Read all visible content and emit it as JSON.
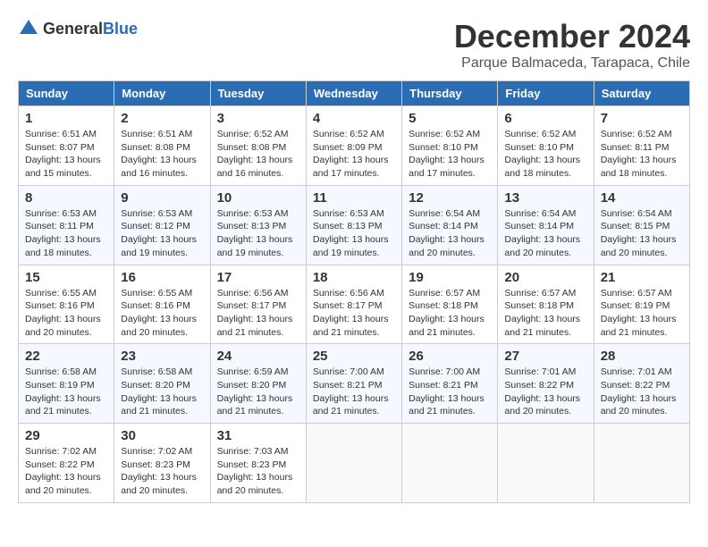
{
  "header": {
    "logo_general": "General",
    "logo_blue": "Blue",
    "month_year": "December 2024",
    "location": "Parque Balmaceda, Tarapaca, Chile"
  },
  "days_of_week": [
    "Sunday",
    "Monday",
    "Tuesday",
    "Wednesday",
    "Thursday",
    "Friday",
    "Saturday"
  ],
  "weeks": [
    [
      {
        "day": 1,
        "sunrise": "6:51 AM",
        "sunset": "8:07 PM",
        "daylight": "13 hours and 15 minutes."
      },
      {
        "day": 2,
        "sunrise": "6:51 AM",
        "sunset": "8:08 PM",
        "daylight": "13 hours and 16 minutes."
      },
      {
        "day": 3,
        "sunrise": "6:52 AM",
        "sunset": "8:08 PM",
        "daylight": "13 hours and 16 minutes."
      },
      {
        "day": 4,
        "sunrise": "6:52 AM",
        "sunset": "8:09 PM",
        "daylight": "13 hours and 17 minutes."
      },
      {
        "day": 5,
        "sunrise": "6:52 AM",
        "sunset": "8:10 PM",
        "daylight": "13 hours and 17 minutes."
      },
      {
        "day": 6,
        "sunrise": "6:52 AM",
        "sunset": "8:10 PM",
        "daylight": "13 hours and 18 minutes."
      },
      {
        "day": 7,
        "sunrise": "6:52 AM",
        "sunset": "8:11 PM",
        "daylight": "13 hours and 18 minutes."
      }
    ],
    [
      {
        "day": 8,
        "sunrise": "6:53 AM",
        "sunset": "8:11 PM",
        "daylight": "13 hours and 18 minutes."
      },
      {
        "day": 9,
        "sunrise": "6:53 AM",
        "sunset": "8:12 PM",
        "daylight": "13 hours and 19 minutes."
      },
      {
        "day": 10,
        "sunrise": "6:53 AM",
        "sunset": "8:13 PM",
        "daylight": "13 hours and 19 minutes."
      },
      {
        "day": 11,
        "sunrise": "6:53 AM",
        "sunset": "8:13 PM",
        "daylight": "13 hours and 19 minutes."
      },
      {
        "day": 12,
        "sunrise": "6:54 AM",
        "sunset": "8:14 PM",
        "daylight": "13 hours and 20 minutes."
      },
      {
        "day": 13,
        "sunrise": "6:54 AM",
        "sunset": "8:14 PM",
        "daylight": "13 hours and 20 minutes."
      },
      {
        "day": 14,
        "sunrise": "6:54 AM",
        "sunset": "8:15 PM",
        "daylight": "13 hours and 20 minutes."
      }
    ],
    [
      {
        "day": 15,
        "sunrise": "6:55 AM",
        "sunset": "8:16 PM",
        "daylight": "13 hours and 20 minutes."
      },
      {
        "day": 16,
        "sunrise": "6:55 AM",
        "sunset": "8:16 PM",
        "daylight": "13 hours and 20 minutes."
      },
      {
        "day": 17,
        "sunrise": "6:56 AM",
        "sunset": "8:17 PM",
        "daylight": "13 hours and 21 minutes."
      },
      {
        "day": 18,
        "sunrise": "6:56 AM",
        "sunset": "8:17 PM",
        "daylight": "13 hours and 21 minutes."
      },
      {
        "day": 19,
        "sunrise": "6:57 AM",
        "sunset": "8:18 PM",
        "daylight": "13 hours and 21 minutes."
      },
      {
        "day": 20,
        "sunrise": "6:57 AM",
        "sunset": "8:18 PM",
        "daylight": "13 hours and 21 minutes."
      },
      {
        "day": 21,
        "sunrise": "6:57 AM",
        "sunset": "8:19 PM",
        "daylight": "13 hours and 21 minutes."
      }
    ],
    [
      {
        "day": 22,
        "sunrise": "6:58 AM",
        "sunset": "8:19 PM",
        "daylight": "13 hours and 21 minutes."
      },
      {
        "day": 23,
        "sunrise": "6:58 AM",
        "sunset": "8:20 PM",
        "daylight": "13 hours and 21 minutes."
      },
      {
        "day": 24,
        "sunrise": "6:59 AM",
        "sunset": "8:20 PM",
        "daylight": "13 hours and 21 minutes."
      },
      {
        "day": 25,
        "sunrise": "7:00 AM",
        "sunset": "8:21 PM",
        "daylight": "13 hours and 21 minutes."
      },
      {
        "day": 26,
        "sunrise": "7:00 AM",
        "sunset": "8:21 PM",
        "daylight": "13 hours and 21 minutes."
      },
      {
        "day": 27,
        "sunrise": "7:01 AM",
        "sunset": "8:22 PM",
        "daylight": "13 hours and 20 minutes."
      },
      {
        "day": 28,
        "sunrise": "7:01 AM",
        "sunset": "8:22 PM",
        "daylight": "13 hours and 20 minutes."
      }
    ],
    [
      {
        "day": 29,
        "sunrise": "7:02 AM",
        "sunset": "8:22 PM",
        "daylight": "13 hours and 20 minutes."
      },
      {
        "day": 30,
        "sunrise": "7:02 AM",
        "sunset": "8:23 PM",
        "daylight": "13 hours and 20 minutes."
      },
      {
        "day": 31,
        "sunrise": "7:03 AM",
        "sunset": "8:23 PM",
        "daylight": "13 hours and 20 minutes."
      },
      null,
      null,
      null,
      null
    ]
  ]
}
